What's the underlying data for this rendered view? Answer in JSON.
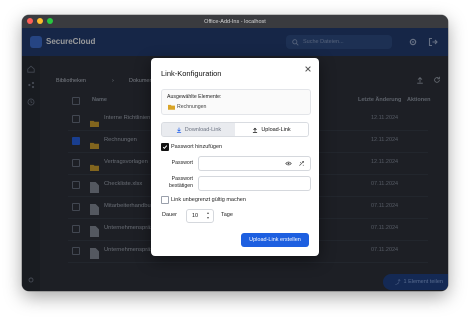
{
  "window": {
    "title": "Office-Add-Ins - localhost"
  },
  "app": {
    "brand": "SecureCloud",
    "search_placeholder": "Suche Dateien..."
  },
  "breadcrumb": [
    "Bibliotheken",
    "Dokumente"
  ],
  "columns": {
    "name": "Name",
    "modified": "Letzte Änderung",
    "actions": "Aktionen"
  },
  "files": [
    {
      "name": "Interne Richtlinien",
      "kind": "folder",
      "date": "12.11.2024",
      "checked": false
    },
    {
      "name": "Rechnungen",
      "kind": "folder",
      "date": "12.11.2024",
      "checked": true
    },
    {
      "name": "Vertragsvorlagen",
      "kind": "folder",
      "date": "12.11.2024",
      "checked": false
    },
    {
      "name": "Checkliste.xlsx",
      "kind": "file",
      "date": "07.11.2024",
      "checked": false
    },
    {
      "name": "Mitarbeiterhandbuch.docx",
      "kind": "file",
      "date": "07.11.2024",
      "checked": false
    },
    {
      "name": "Unternehmenspräsentation.pptx",
      "kind": "file",
      "date": "07.11.2024",
      "checked": false
    },
    {
      "name": "Unternehmenspräsentation_v2.pptx",
      "kind": "file",
      "date": "07.11.2024",
      "checked": false
    }
  ],
  "share_button": "1 Element teilen",
  "dialog": {
    "title": "Link-Konfiguration",
    "selected_label": "Ausgewählte Elemente:",
    "selected_item": "Rechnungen",
    "tab_download": "Download-Link",
    "tab_upload": "Upload-Link",
    "active_tab": "upload",
    "password_toggle": "Passwort hinzufügen",
    "password_checked": true,
    "password_label": "Passwort",
    "password_value": "",
    "password_confirm_label_1": "Passwort",
    "password_confirm_label_2": "bestätigen",
    "password_confirm_value": "",
    "unlimited_label": "Link unbegrenzt gültig machen",
    "unlimited_checked": false,
    "duration_label": "Dauer",
    "duration_value": "10",
    "duration_unit": "Tage",
    "submit_label": "Upload-Link erstellen"
  },
  "colors": {
    "accent": "#1d5fe0",
    "header": "#1f3a6e",
    "folder": "#d9a528"
  }
}
